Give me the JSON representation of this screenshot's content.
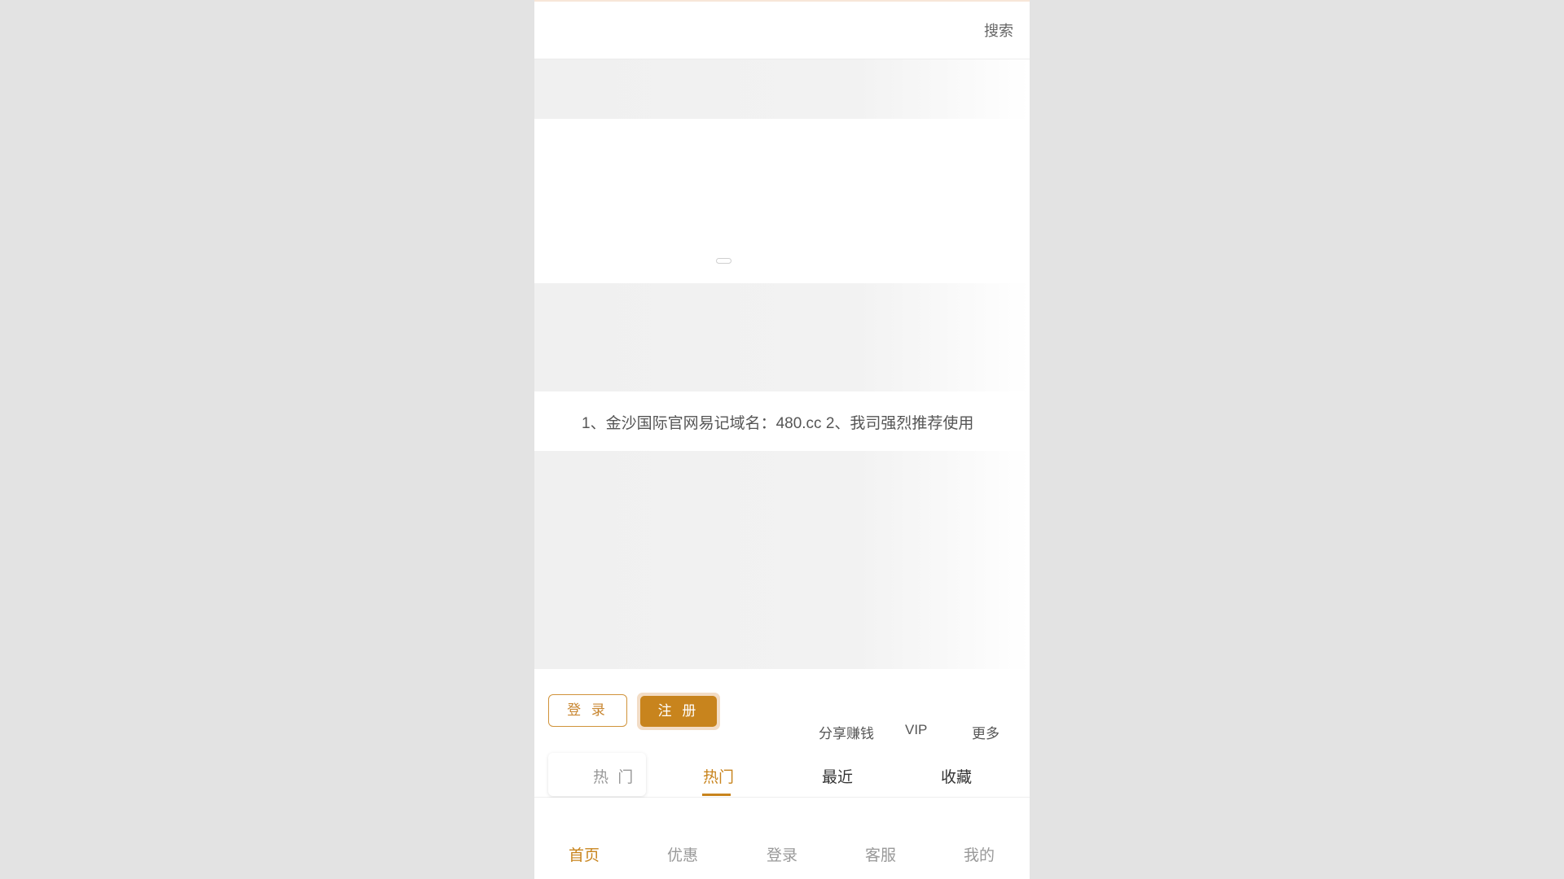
{
  "header": {
    "search_label": "搜索"
  },
  "notice": {
    "text": "1、金沙国际官网易记域名：480.cc 2、我司强烈推荐使用"
  },
  "auth": {
    "login_label": "登 录",
    "register_label": "注 册"
  },
  "quick_links": [
    "分享赚钱",
    "VIP",
    "更多"
  ],
  "tabs": {
    "floating_label": "热 门",
    "items": [
      {
        "label": "热门",
        "active": true
      },
      {
        "label": "最近",
        "active": false
      },
      {
        "label": "收藏",
        "active": false
      }
    ]
  },
  "bottom_nav": {
    "items": [
      {
        "label": "首页",
        "active": true
      },
      {
        "label": "优惠",
        "active": false
      },
      {
        "label": "登录",
        "active": false
      },
      {
        "label": "客服",
        "active": false
      },
      {
        "label": "我的",
        "active": false
      }
    ]
  },
  "colors": {
    "accent": "#c8841d",
    "background": "#e3e3e3",
    "panel": "#ffffff"
  }
}
